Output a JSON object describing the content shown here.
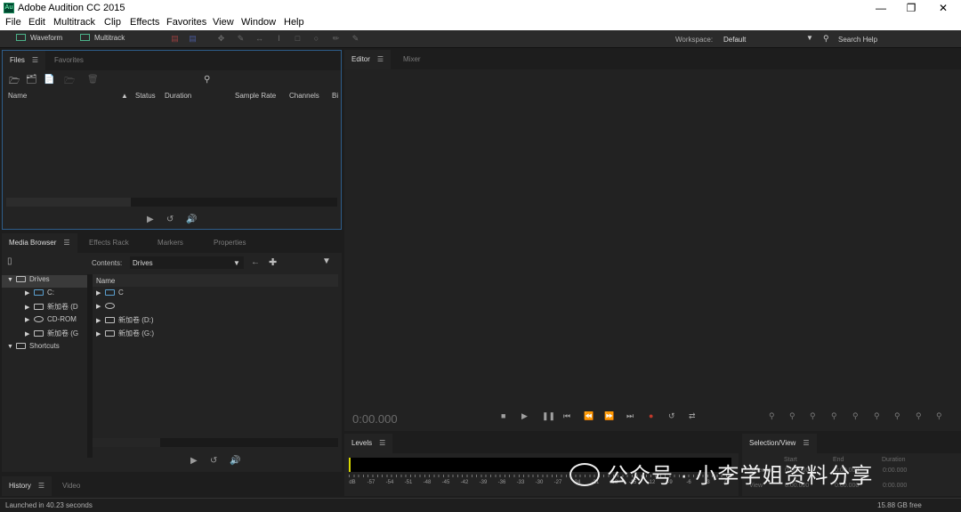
{
  "window": {
    "title": "Adobe Audition CC 2015",
    "app_icon": "Au",
    "controls": [
      "minimize-icon",
      "restore-icon",
      "close-icon"
    ]
  },
  "menu": [
    "File",
    "Edit",
    "Multitrack",
    "Clip",
    "Effects",
    "Favorites",
    "View",
    "Window",
    "Help"
  ],
  "toolbar": {
    "waveform_label": "Waveform",
    "multitrack_label": "Multitrack",
    "workspace_label": "Workspace:",
    "workspace_value": "Default",
    "search_label": "Search Help"
  },
  "files_panel": {
    "tabs": [
      "Files",
      "Favorites"
    ],
    "columns": [
      "Name",
      "Status",
      "Duration",
      "Sample Rate",
      "Channels",
      "Bi"
    ]
  },
  "media_browser": {
    "tabs": [
      "Media Browser",
      "Effects Rack",
      "Markers",
      "Properties"
    ],
    "contents_label": "Contents:",
    "contents_value": "Drives",
    "tree": [
      {
        "label": "Drives",
        "expanded": true
      },
      {
        "label": "C:"
      },
      {
        "label": "新加卷 (D"
      },
      {
        "label": "CD-ROM"
      },
      {
        "label": "新加卷 (G"
      },
      {
        "label": "Shortcuts",
        "expanded": true
      }
    ],
    "list_header": "Name",
    "list_items": [
      "C",
      "",
      "新加卷 (D:)",
      "新加卷 (G:)"
    ]
  },
  "bottom_tabs": [
    "History",
    "Video"
  ],
  "editor": {
    "tabs": [
      "Editor",
      "Mixer"
    ],
    "time": "0:00.000"
  },
  "levels": {
    "title": "Levels",
    "scale": [
      "dB",
      "-57",
      "-54",
      "-51",
      "-48",
      "-45",
      "-42",
      "-39",
      "-36",
      "-33",
      "-30",
      "-27",
      "-24",
      "-21",
      "-18",
      "-15",
      "-12",
      "-9",
      "-6",
      "-3",
      "0"
    ]
  },
  "selection_view": {
    "title": "Selection/View",
    "headers": [
      "Start",
      "End",
      "Duration"
    ],
    "rows": [
      {
        "label": "Selection",
        "start": "0:00.000",
        "end": "0:00.000",
        "duration": "0:00.000"
      },
      {
        "label": "View",
        "start": "0:00.000",
        "end": "0:00.000",
        "duration": "0:00.000"
      }
    ]
  },
  "status": {
    "left": "Launched in 40.23 seconds",
    "right": "15.88 GB free"
  },
  "watermark": "公众号 · 小李学姐资料分享",
  "colors": {
    "background": "#232323",
    "accent_green": "#4cb38a",
    "record_red": "#c0392b",
    "focus_blue": "#2e5d8a"
  }
}
